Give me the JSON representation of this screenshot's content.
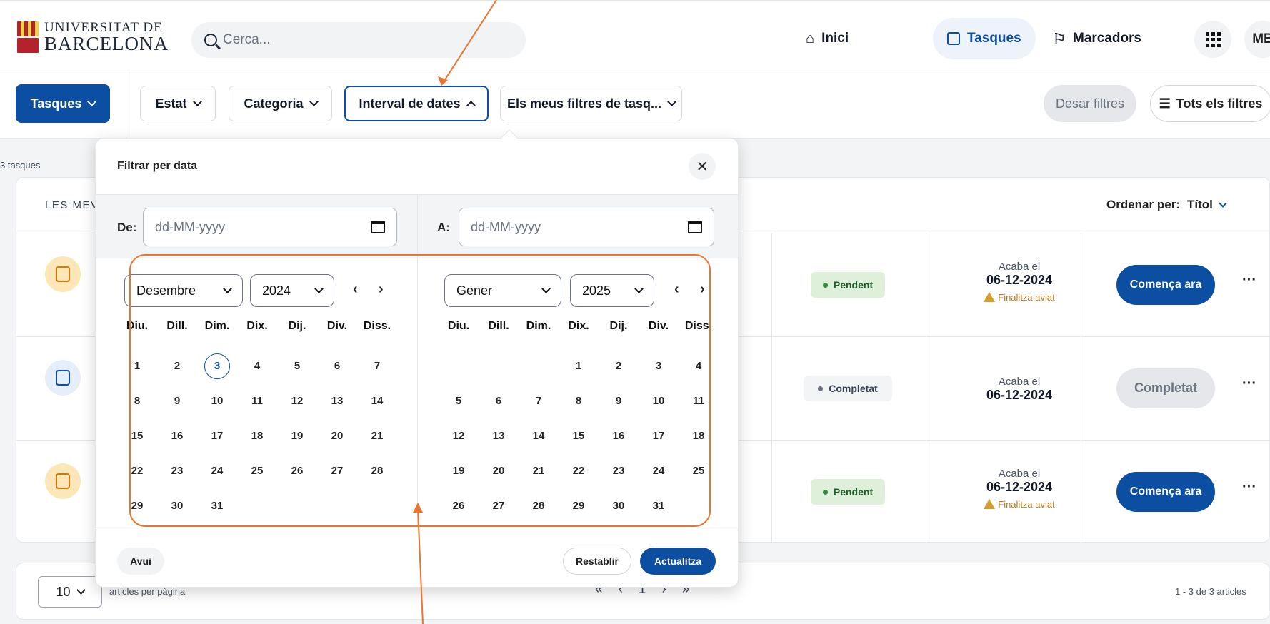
{
  "header": {
    "logo_top": "UNIVERSITAT DE",
    "logo_bottom": "BARCELONA",
    "search_placeholder": "Cerca...",
    "nav": [
      {
        "label": "Inici",
        "icon": "home-icon"
      },
      {
        "label": "Tasques",
        "icon": "task-icon"
      },
      {
        "label": "Marcadors",
        "icon": "bookmark-icon"
      }
    ],
    "user_initials": "MB"
  },
  "filters": {
    "primary": "Tasques",
    "chips": [
      "Estat",
      "Categoria",
      "Interval de dates",
      "Els meus filtres de tasq..."
    ],
    "clear": "Desar filtres",
    "all": "Tots els filtres"
  },
  "main": {
    "count": "3 tasques",
    "list_title": "LES MEV",
    "sort_label": "Ordenar per:",
    "sort_value": "Títol"
  },
  "tasks": [
    {
      "status": "Pendent",
      "due_label": "Acaba el",
      "due_date": "06-12-2024",
      "warning": "Finalitza aviat",
      "action": "Comença ara",
      "icon_color": "#d97706"
    },
    {
      "status": "Completat",
      "due_label": "Acaba el",
      "due_date": "06-12-2024",
      "warning": "",
      "action": "Completat",
      "icon_color": "#0b4ea2"
    },
    {
      "status": "Pendent",
      "due_label": "Acaba el",
      "due_date": "06-12-2024",
      "warning": "Finalitza aviat",
      "action": "Comença ara",
      "icon_color": "#d97706"
    }
  ],
  "pager": {
    "per_page": "10",
    "per_page_label": "articles per pàgina",
    "current": "1",
    "range": "1 - 3 de 3 articles"
  },
  "popover": {
    "title": "Filtrar per data",
    "from_label": "De:",
    "to_label": "A:",
    "date_placeholder": "dd-MM-yyyy",
    "left": {
      "month": "Desembre",
      "year": "2024"
    },
    "right": {
      "month": "Gener",
      "year": "2025"
    },
    "weekdays": [
      "Diu.",
      "Dill.",
      "Dim.",
      "Dix.",
      "Dij.",
      "Div.",
      "Diss."
    ],
    "today_button": "Avui",
    "reset_button": "Restablir",
    "update_button": "Actualitza"
  },
  "colors": {
    "primary": "#0b4ea2",
    "pending_bg": "#dff0da",
    "pending_dot": "#2f8a3a",
    "completed_bg": "#f3f4f6",
    "annotation": "#e8762e"
  }
}
